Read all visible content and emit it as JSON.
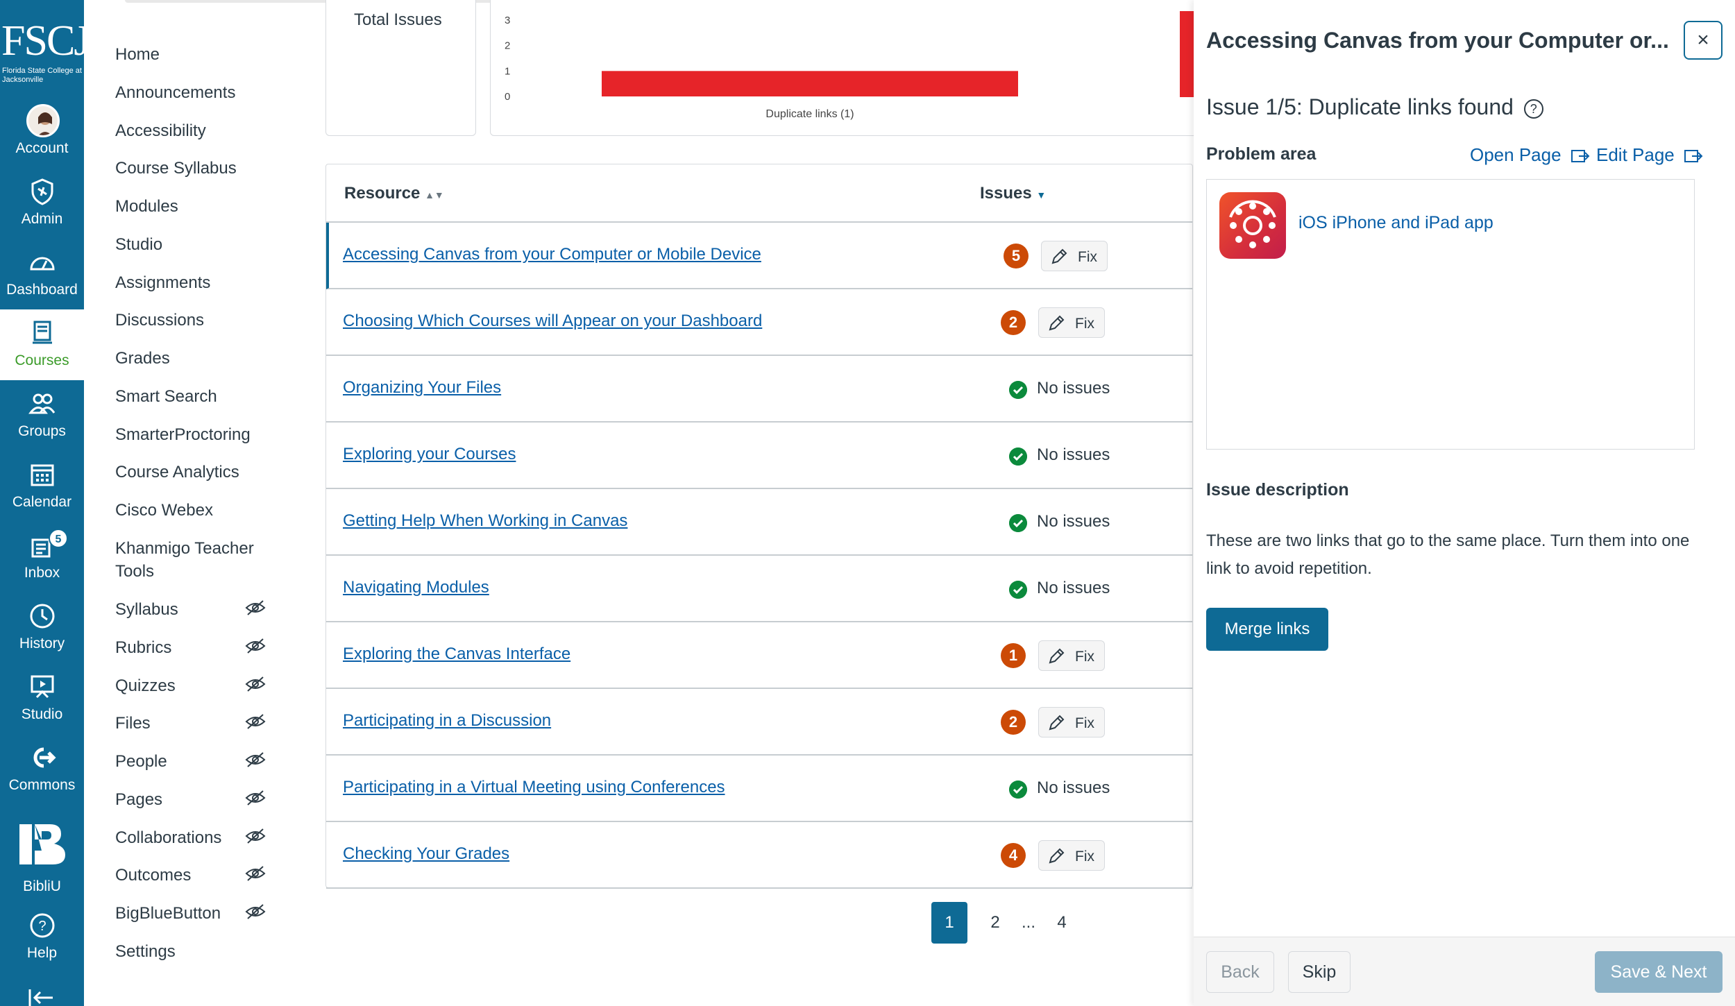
{
  "global_nav": {
    "logo_text": "FSCJ",
    "logo_subtext": "Florida State College at Jacksonville",
    "items": [
      {
        "label": "Account",
        "icon": "avatar"
      },
      {
        "label": "Admin",
        "icon": "shield-icon"
      },
      {
        "label": "Dashboard",
        "icon": "dashboard-icon"
      },
      {
        "label": "Courses",
        "icon": "courses-icon"
      },
      {
        "label": "Groups",
        "icon": "groups-icon"
      },
      {
        "label": "Calendar",
        "icon": "calendar-icon"
      },
      {
        "label": "Inbox",
        "icon": "inbox-icon",
        "badge": "5"
      },
      {
        "label": "History",
        "icon": "clock-icon"
      },
      {
        "label": "Studio",
        "icon": "studio-icon"
      },
      {
        "label": "Commons",
        "icon": "commons-icon"
      },
      {
        "label": "BibliU",
        "icon": "bibliu-icon"
      },
      {
        "label": "Help",
        "icon": "help-icon"
      }
    ]
  },
  "course_nav": {
    "items": [
      {
        "label": "Home"
      },
      {
        "label": "Announcements"
      },
      {
        "label": "Accessibility"
      },
      {
        "label": "Course Syllabus"
      },
      {
        "label": "Modules"
      },
      {
        "label": "Studio"
      },
      {
        "label": "Assignments"
      },
      {
        "label": "Discussions"
      },
      {
        "label": "Grades"
      },
      {
        "label": "Smart Search"
      },
      {
        "label": "SmarterProctoring"
      },
      {
        "label": "Course Analytics"
      },
      {
        "label": "Cisco Webex"
      },
      {
        "label": "Khanmigo Teacher Tools"
      },
      {
        "label": "Syllabus",
        "hidden": true
      },
      {
        "label": "Rubrics",
        "hidden": true
      },
      {
        "label": "Quizzes",
        "hidden": true
      },
      {
        "label": "Files",
        "hidden": true
      },
      {
        "label": "People",
        "hidden": true
      },
      {
        "label": "Pages",
        "hidden": true
      },
      {
        "label": "Collaborations",
        "hidden": true
      },
      {
        "label": "Outcomes",
        "hidden": true
      },
      {
        "label": "BigBlueButton",
        "hidden": true
      },
      {
        "label": "Settings"
      }
    ]
  },
  "summary": {
    "total_issues_label": "Total Issues"
  },
  "chart_data": {
    "type": "bar",
    "categories": [
      "Duplicate links (1)"
    ],
    "values": [
      1
    ],
    "ylim": [
      0,
      3
    ],
    "yticks": [
      "3",
      "2",
      "1",
      "0"
    ],
    "bar_color": "#e62429"
  },
  "table": {
    "col_resource": "Resource",
    "col_issues": "Issues",
    "fix_label": "Fix",
    "no_issues_label": "No issues",
    "rows": [
      {
        "title": "Accessing Canvas from your Computer or Mobile Device",
        "issues": "5"
      },
      {
        "title": "Choosing Which Courses will Appear on your Dashboard",
        "issues": "2"
      },
      {
        "title": "Organizing Your Files",
        "issues": null
      },
      {
        "title": "Exploring your Courses",
        "issues": null
      },
      {
        "title": "Getting Help When Working in Canvas",
        "issues": null
      },
      {
        "title": "Navigating Modules",
        "issues": null
      },
      {
        "title": "Exploring the Canvas Interface",
        "issues": "1"
      },
      {
        "title": "Participating in a Discussion",
        "issues": "2"
      },
      {
        "title": "Participating in a Virtual Meeting using Conferences",
        "issues": null
      },
      {
        "title": "Checking Your Grades",
        "issues": "4"
      }
    ]
  },
  "pagination": {
    "pages": [
      "1",
      "2",
      "...",
      "4"
    ],
    "current": "1"
  },
  "panel": {
    "title": "Accessing Canvas from your Computer or...",
    "close_label": "×",
    "issue_heading": "Issue 1/5: Duplicate links found",
    "problem_area_label": "Problem area",
    "open_page_label": "Open Page",
    "edit_page_label": "Edit Page",
    "preview_link": "iOS iPhone and iPad app",
    "issue_description_label": "Issue description",
    "description": "These are two links that go to the same place. Turn them into one link to avoid repetition.",
    "merge_button": "Merge links",
    "back_button": "Back",
    "skip_button": "Skip",
    "save_next_button": "Save & Next"
  }
}
